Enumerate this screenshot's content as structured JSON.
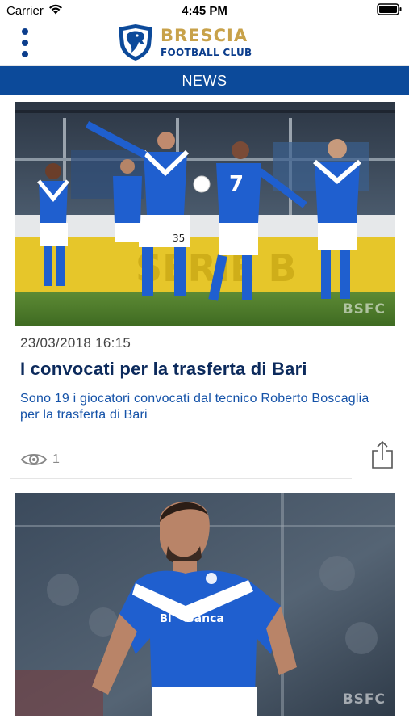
{
  "status_bar": {
    "carrier": "Carrier",
    "time": "4:45 PM"
  },
  "header": {
    "club_name": "BRESCIA",
    "club_subtitle": "FOOTBALL CLUB"
  },
  "section": {
    "title": "NEWS"
  },
  "articles": [
    {
      "date": "23/03/2018 16:15",
      "title": "I convocati per la trasferta di Bari",
      "summary": "Sono 19 i giocatori convocati dal tecnico Roberto Boscaglia per la trasferta di Bari",
      "views": "1",
      "photo_watermark": "BSFC",
      "jersey_number": "7",
      "shorts_number": "35"
    },
    {
      "photo_watermark": "BSFC",
      "sponsor": "Banca",
      "sponsor_prefix": "BI"
    }
  ],
  "colors": {
    "primary_blue": "#0c4a9a",
    "gold": "#c8a24a",
    "title_navy": "#0c2a5c",
    "summary_blue": "#1452a8"
  },
  "icons": {
    "menu": "vertical-dots-icon",
    "views": "eye-icon",
    "share": "share-icon",
    "wifi": "wifi-icon",
    "battery": "battery-icon"
  }
}
